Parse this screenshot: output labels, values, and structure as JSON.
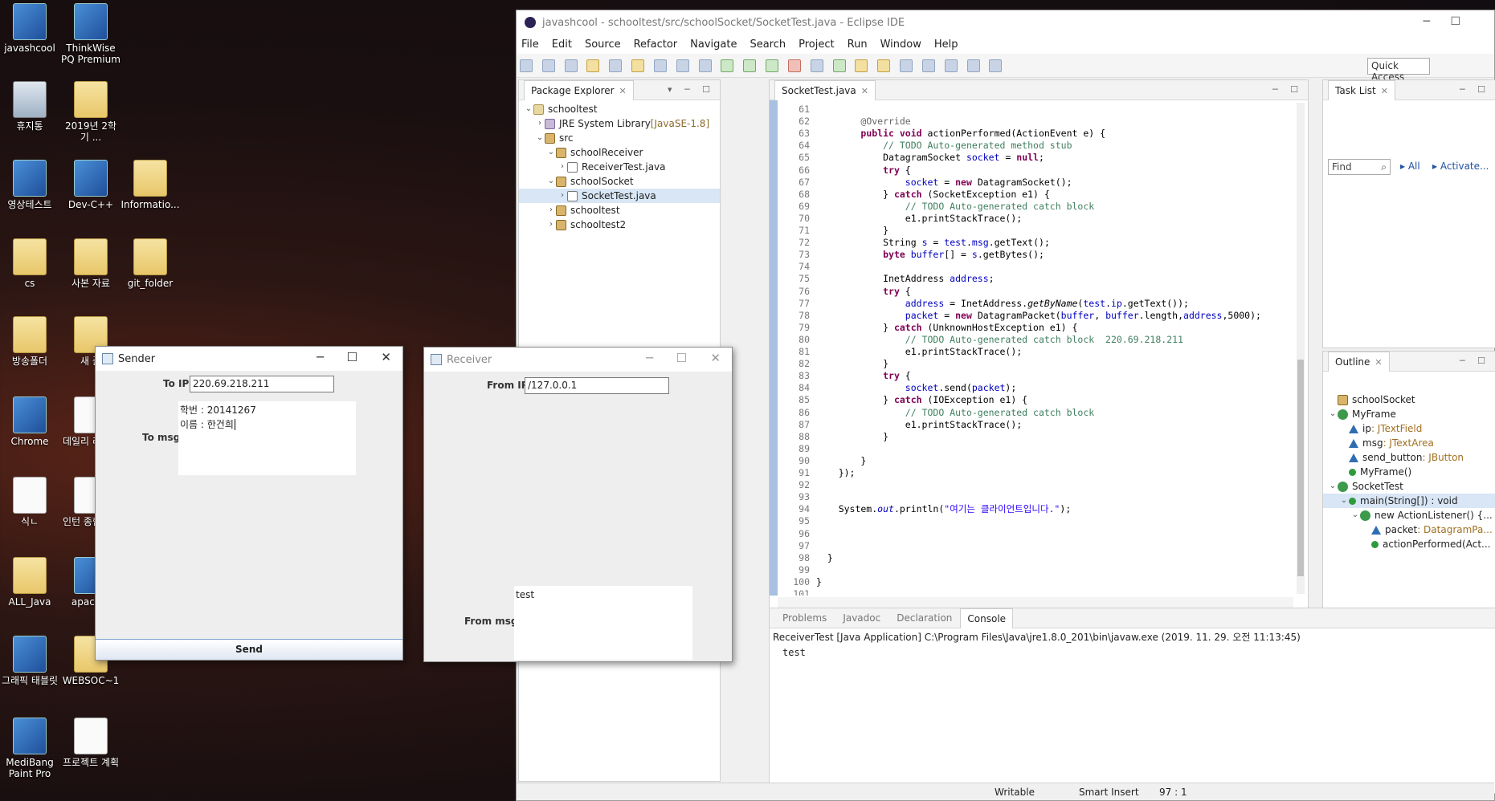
{
  "desktop": {
    "icons": [
      {
        "label": "javashcool",
        "kind": "app"
      },
      {
        "label": "ThinkWise PQ Premium",
        "kind": "app"
      },
      {
        "label": "휴지통",
        "kind": "bin"
      },
      {
        "label": "2019년 2학기 ...",
        "kind": "folder"
      },
      {
        "label": "영상테스트",
        "kind": "app"
      },
      {
        "label": "Dev-C++",
        "kind": "app"
      },
      {
        "label": "Informatio...",
        "kind": "folder"
      },
      {
        "label": "cs",
        "kind": "folder"
      },
      {
        "label": "사본 자료",
        "kind": "folder"
      },
      {
        "label": "git_folder",
        "kind": "folder"
      },
      {
        "label": "방송폴더",
        "kind": "folder"
      },
      {
        "label": "새 폴",
        "kind": "folder"
      },
      {
        "label": "Chrome",
        "kind": "app"
      },
      {
        "label": "데일리 리포트",
        "kind": "doc"
      },
      {
        "label": "식ㄴ",
        "kind": "doc"
      },
      {
        "label": "인턴 종합보고",
        "kind": "doc"
      },
      {
        "label": "ALL_Java",
        "kind": "folder"
      },
      {
        "label": "apache-",
        "kind": "app"
      },
      {
        "label": "그래픽 태블릿",
        "kind": "app"
      },
      {
        "label": "WEBSOC~1",
        "kind": "folder"
      },
      {
        "label": "MediBang Paint Pro",
        "kind": "app"
      },
      {
        "label": "프로젝트 계획",
        "kind": "doc"
      }
    ]
  },
  "sender": {
    "title": "Sender",
    "ip_label": "To IP",
    "ip_value": "220.69.218.211",
    "msg_label": "To msg",
    "msg_lines": [
      "학번 : 20141267",
      "이름 : 한건희"
    ],
    "send_label": "Send"
  },
  "receiver": {
    "title": "Receiver",
    "ip_label": "From IP",
    "ip_value": "/127.0.0.1",
    "msg_label": "From msg",
    "msg_value": "test"
  },
  "eclipse": {
    "title": "javashcool - schooltest/src/schoolSocket/SocketTest.java - Eclipse IDE",
    "menu": [
      "File",
      "Edit",
      "Source",
      "Refactor",
      "Navigate",
      "Search",
      "Project",
      "Run",
      "Window",
      "Help"
    ],
    "quick_access": "Quick Access",
    "package_explorer": {
      "tab": "Package Explorer",
      "items": [
        {
          "label": "schooltest",
          "icon": "proj",
          "depth": 0,
          "twisty": "v"
        },
        {
          "label": "JRE System Library",
          "extra": "[JavaSE-1.8]",
          "icon": "lib",
          "depth": 1,
          "twisty": ">"
        },
        {
          "label": "src",
          "icon": "pkg",
          "depth": 1,
          "twisty": "v"
        },
        {
          "label": "schoolReceiver",
          "icon": "pkg",
          "depth": 2,
          "twisty": "v"
        },
        {
          "label": "ReceiverTest.java",
          "icon": "jf",
          "depth": 3,
          "twisty": ">"
        },
        {
          "label": "schoolSocket",
          "icon": "pkg",
          "depth": 2,
          "twisty": "v"
        },
        {
          "label": "SocketTest.java",
          "icon": "jf",
          "depth": 3,
          "twisty": ">",
          "selected": true
        },
        {
          "label": "schooltest",
          "icon": "pkg",
          "depth": 2,
          "twisty": ">"
        },
        {
          "label": "schooltest2",
          "icon": "pkg",
          "depth": 2,
          "twisty": ">"
        }
      ]
    },
    "editor_tab": "SocketTest.java",
    "code_lines": [
      {
        "n": "61",
        "html": ""
      },
      {
        "n": "62",
        "html": "        <span class='an'>@Override</span>"
      },
      {
        "n": "63",
        "html": "        <span class='kw'>public void</span> actionPerformed(ActionEvent e) {"
      },
      {
        "n": "64",
        "html": "            <span class='cm'>// TODO Auto-generated method stub</span>"
      },
      {
        "n": "65",
        "html": "            DatagramSocket <span class='fi'>socket</span> = <span class='kw'>null</span>;"
      },
      {
        "n": "66",
        "html": "            <span class='kw'>try</span> {"
      },
      {
        "n": "67",
        "html": "                <span class='fi'>socket</span> = <span class='kw'>new</span> DatagramSocket();"
      },
      {
        "n": "68",
        "html": "            } <span class='kw'>catch</span> (SocketException e1) {"
      },
      {
        "n": "69",
        "html": "                <span class='cm'>// TODO Auto-generated catch block</span>"
      },
      {
        "n": "70",
        "html": "                e1.printStackTrace();"
      },
      {
        "n": "71",
        "html": "            }"
      },
      {
        "n": "72",
        "html": "            String <span class='fi'>s</span> = <span class='fi'>test</span>.<span class='fi'>msg</span>.getText();"
      },
      {
        "n": "73",
        "html": "            <span class='kw'>byte</span> <span class='fi'>buffer</span>[] = <span class='fi'>s</span>.getBytes();"
      },
      {
        "n": "74",
        "html": ""
      },
      {
        "n": "75",
        "html": "            InetAddress <span class='fi'>address</span>;"
      },
      {
        "n": "76",
        "html": "            <span class='kw'>try</span> {"
      },
      {
        "n": "77",
        "html": "                <span class='fi'>address</span> = InetAddress.<span class='it'>getByName</span>(<span class='fi'>test</span>.<span class='fi'>ip</span>.getText());"
      },
      {
        "n": "78",
        "html": "                <span class='fi'>packet</span> = <span class='kw'>new</span> DatagramPacket(<span class='fi'>buffer</span>, <span class='fi'>buffer</span>.length,<span class='fi'>address</span>,5000);"
      },
      {
        "n": "79",
        "html": "            } <span class='kw'>catch</span> (UnknownHostException e1) {"
      },
      {
        "n": "80",
        "html": "                <span class='cm'>// TODO Auto-generated catch block  220.69.218.211</span>"
      },
      {
        "n": "81",
        "html": "                e1.printStackTrace();"
      },
      {
        "n": "82",
        "html": "            }"
      },
      {
        "n": "83",
        "html": "            <span class='kw'>try</span> {"
      },
      {
        "n": "84",
        "html": "                <span class='fi'>socket</span>.send(<span class='fi'>packet</span>);"
      },
      {
        "n": "85",
        "html": "            } <span class='kw'>catch</span> (IOException e1) {"
      },
      {
        "n": "86",
        "html": "                <span class='cm'>// TODO Auto-generated catch block</span>"
      },
      {
        "n": "87",
        "html": "                e1.printStackTrace();"
      },
      {
        "n": "88",
        "html": "            }"
      },
      {
        "n": "89",
        "html": ""
      },
      {
        "n": "90",
        "html": "        }"
      },
      {
        "n": "91",
        "html": "    });"
      },
      {
        "n": "92",
        "html": ""
      },
      {
        "n": "93",
        "html": ""
      },
      {
        "n": "94",
        "html": "    System.<span class='fi it'>out</span>.println(<span class='st'>\"여기는 클라이언트입니다.\"</span>);"
      },
      {
        "n": "95",
        "html": ""
      },
      {
        "n": "96",
        "html": ""
      },
      {
        "n": "97",
        "html": ""
      },
      {
        "n": "98",
        "html": "  }"
      },
      {
        "n": "99",
        "html": ""
      },
      {
        "n": "100",
        "html": "}"
      },
      {
        "n": "101",
        "html": ""
      }
    ],
    "task_list": {
      "tab": "Task List",
      "find": "Find",
      "all": "All",
      "activate": "Activate..."
    },
    "outline": {
      "tab": "Outline",
      "items": [
        {
          "label": "schoolSocket",
          "icon": "pkg",
          "depth": 0,
          "twisty": ""
        },
        {
          "label": "MyFrame",
          "icon": "cls",
          "depth": 0,
          "twisty": "v"
        },
        {
          "label": "ip",
          "type": " : JTextField",
          "icon": "fld",
          "depth": 1,
          "twisty": ""
        },
        {
          "label": "msg",
          "type": " : JTextArea",
          "icon": "fld",
          "depth": 1,
          "twisty": ""
        },
        {
          "label": "send_button",
          "type": " : JButton",
          "icon": "fld",
          "depth": 1,
          "twisty": ""
        },
        {
          "label": "MyFrame()",
          "icon": "mth",
          "depth": 1,
          "twisty": ""
        },
        {
          "label": "SocketTest",
          "icon": "cls",
          "depth": 0,
          "twisty": "v"
        },
        {
          "label": "main(String[]) : void",
          "icon": "mth",
          "depth": 1,
          "twisty": "v",
          "selected": true
        },
        {
          "label": "new ActionListener() {...",
          "icon": "cls",
          "depth": 2,
          "twisty": "v"
        },
        {
          "label": "packet",
          "type": " : DatagramPa...",
          "icon": "fld",
          "depth": 3,
          "twisty": ""
        },
        {
          "label": "actionPerformed(Act...",
          "icon": "mth",
          "depth": 3,
          "twisty": ""
        }
      ]
    },
    "bottom_tabs": [
      "Problems",
      "Javadoc",
      "Declaration",
      "Console"
    ],
    "console_header": "ReceiverTest [Java Application] C:\\Program Files\\Java\\jre1.8.0_201\\bin\\javaw.exe (2019. 11. 29. 오전 11:13:45)",
    "console_output": "test",
    "status": {
      "writable": "Writable",
      "insert": "Smart Insert",
      "position": "97 : 1"
    }
  }
}
